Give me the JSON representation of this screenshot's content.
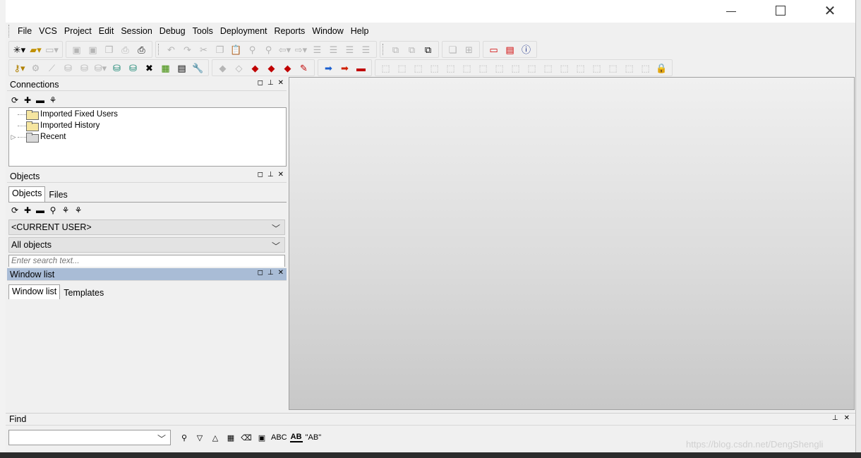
{
  "window": {
    "controls": {
      "minimize": "—",
      "maximize": "",
      "close": "✕"
    }
  },
  "menu": {
    "items": [
      "File",
      "VCS",
      "Project",
      "Edit",
      "Session",
      "Debug",
      "Tools",
      "Deployment",
      "Reports",
      "Window",
      "Help"
    ]
  },
  "toolbar": {
    "row1": [
      [
        "new-icon",
        "open-icon",
        "print-setup-icon"
      ],
      [
        "save-icon",
        "save-as-icon",
        "save-all-icon",
        "print-icon",
        "print-preview-icon"
      ],
      [
        "undo-icon",
        "redo-icon",
        "cut-icon",
        "copy-icon",
        "paste-icon",
        "find-icon",
        "replace-icon",
        "back-icon",
        "forward-icon",
        "indent-icon",
        "unindent-icon",
        "uncomment-icon",
        "comment-icon"
      ],
      [
        "windows-icon",
        "windows-list-icon",
        "windows-arrange-icon"
      ],
      [
        "cascade-icon",
        "tile-icon"
      ],
      [
        "oracle-icon",
        "pdf-icon",
        "info-icon"
      ]
    ],
    "row2": [
      [
        "key-icon",
        "gear-icon",
        "wand-icon",
        "db-icon",
        "db-export-icon",
        "sql-icon",
        "db-green-icon",
        "db-red-icon",
        "tools-icon",
        "chart-icon",
        "doc-icon",
        "wrench-icon"
      ],
      [
        "eraser-icon",
        "eraser2-icon",
        "red-cube-icon",
        "red-yellow-icon",
        "red-pencil-icon",
        "red-brush-icon"
      ],
      [
        "blue-arrow-icon",
        "red-arrow-icon",
        "stop-icon"
      ],
      [
        "step-icon",
        "step2-icon",
        "step3-icon",
        "step4-icon",
        "step5-icon",
        "step6-icon",
        "step7-icon",
        "step8-icon",
        "step9-icon",
        "step10-icon",
        "step11-icon",
        "step12-icon",
        "step13-icon",
        "step14-icon",
        "step15-icon",
        "step16-icon",
        "step17-icon",
        "lock-icon"
      ]
    ]
  },
  "connections": {
    "title": "Connections",
    "tree": [
      {
        "label": "Imported Fixed Users",
        "expandable": false,
        "folder": "yellow"
      },
      {
        "label": "Imported History",
        "expandable": false,
        "folder": "yellow"
      },
      {
        "label": "Recent",
        "expandable": true,
        "folder": "gray"
      }
    ]
  },
  "objects": {
    "title": "Objects",
    "tabs": [
      "Objects",
      "Files"
    ],
    "user_combo": "<CURRENT USER>",
    "type_combo": "All objects",
    "search_placeholder": "Enter search text..."
  },
  "window_list": {
    "title": "Window list",
    "tabs": [
      "Window list",
      "Templates"
    ]
  },
  "find": {
    "title": "Find",
    "tools": [
      "ABC",
      "AB",
      "\"AB\""
    ]
  },
  "watermark": "https://blog.csdn.net/DengShengli",
  "colors": {
    "active_panel_header": "#a9bcd6",
    "background": "#f0f0f0"
  }
}
